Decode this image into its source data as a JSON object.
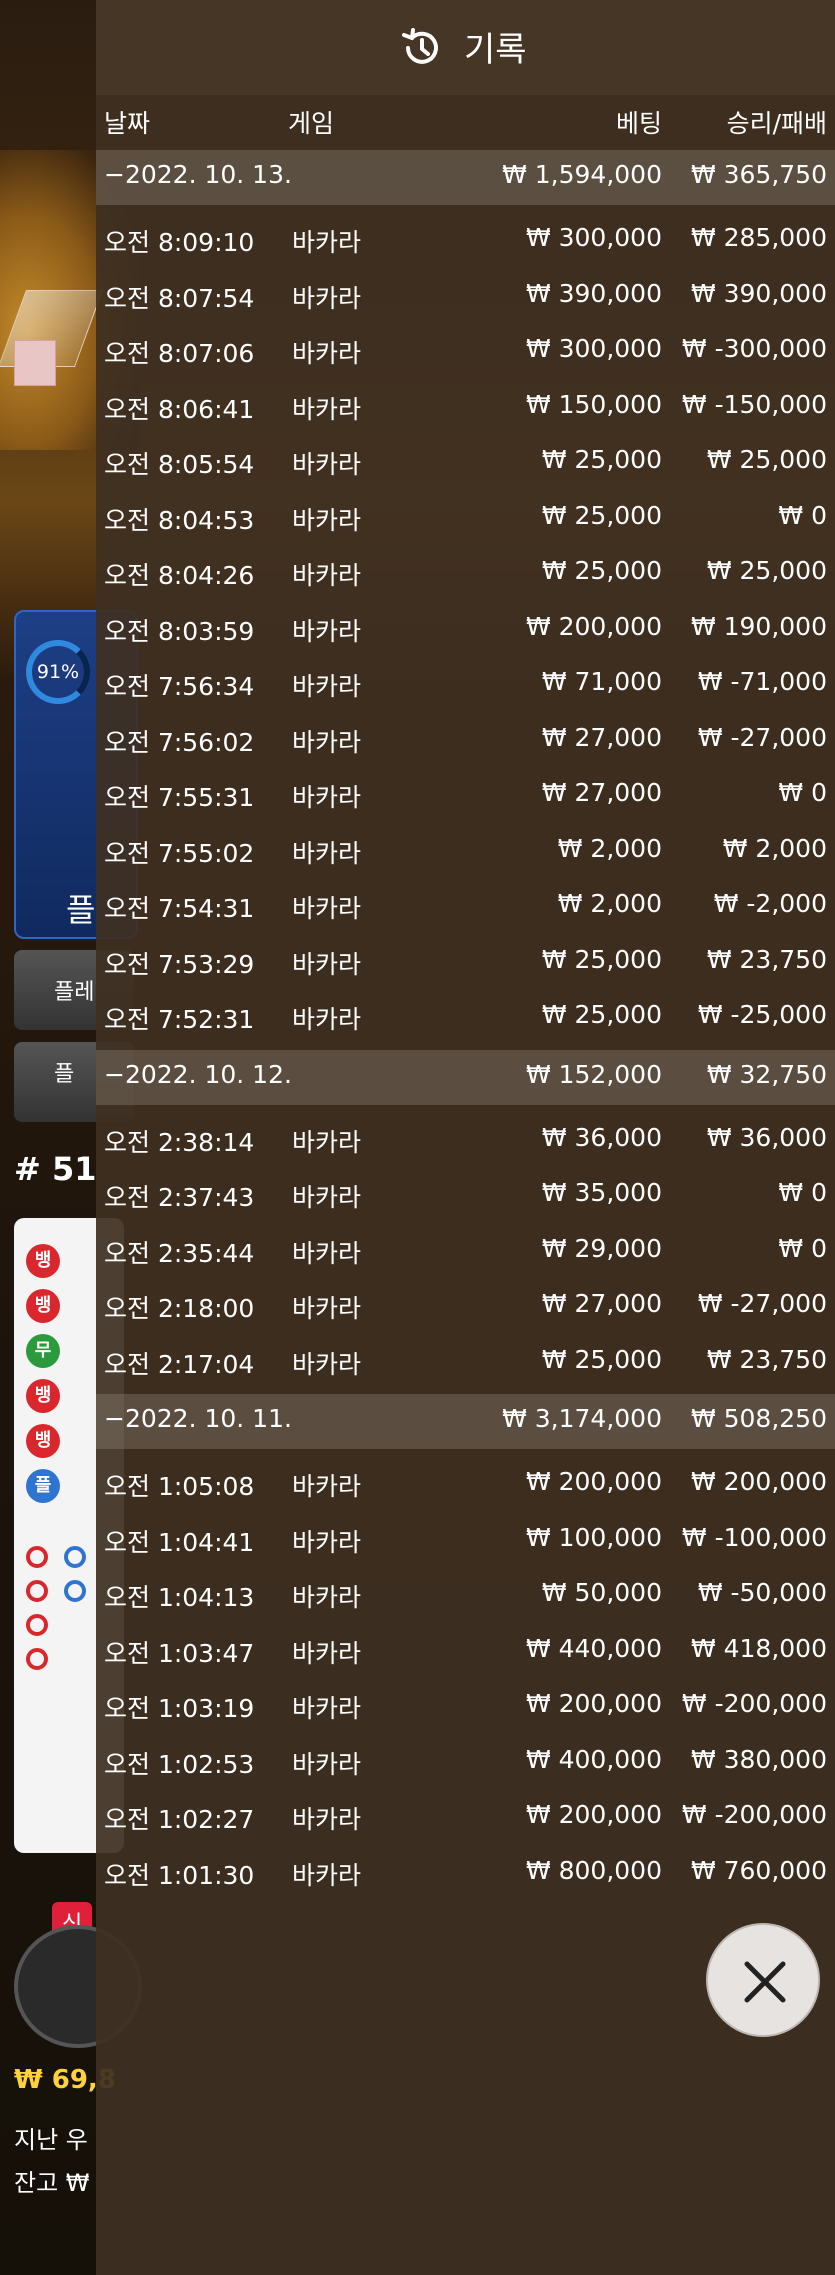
{
  "header": {
    "title": "기록",
    "icon": "history-icon"
  },
  "columns": {
    "date": "날짜",
    "game": "게임",
    "bet": "베팅",
    "result": "승리/패배"
  },
  "groups": [
    {
      "date": "−2022. 10. 13.",
      "bet": "₩ 1,594,000",
      "result": "₩ 365,750",
      "rows": [
        {
          "time": "오전 8:09:10",
          "game": "바카라",
          "bet": "₩ 300,000",
          "result": "₩ 285,000"
        },
        {
          "time": "오전 8:07:54",
          "game": "바카라",
          "bet": "₩ 390,000",
          "result": "₩ 390,000"
        },
        {
          "time": "오전 8:07:06",
          "game": "바카라",
          "bet": "₩ 300,000",
          "result": "₩ -300,000"
        },
        {
          "time": "오전 8:06:41",
          "game": "바카라",
          "bet": "₩ 150,000",
          "result": "₩ -150,000"
        },
        {
          "time": "오전 8:05:54",
          "game": "바카라",
          "bet": "₩ 25,000",
          "result": "₩ 25,000"
        },
        {
          "time": "오전 8:04:53",
          "game": "바카라",
          "bet": "₩ 25,000",
          "result": "₩ 0"
        },
        {
          "time": "오전 8:04:26",
          "game": "바카라",
          "bet": "₩ 25,000",
          "result": "₩ 25,000"
        },
        {
          "time": "오전 8:03:59",
          "game": "바카라",
          "bet": "₩ 200,000",
          "result": "₩ 190,000"
        },
        {
          "time": "오전 7:56:34",
          "game": "바카라",
          "bet": "₩ 71,000",
          "result": "₩ -71,000"
        },
        {
          "time": "오전 7:56:02",
          "game": "바카라",
          "bet": "₩ 27,000",
          "result": "₩ -27,000"
        },
        {
          "time": "오전 7:55:31",
          "game": "바카라",
          "bet": "₩ 27,000",
          "result": "₩ 0"
        },
        {
          "time": "오전 7:55:02",
          "game": "바카라",
          "bet": "₩ 2,000",
          "result": "₩ 2,000"
        },
        {
          "time": "오전 7:54:31",
          "game": "바카라",
          "bet": "₩ 2,000",
          "result": "₩ -2,000"
        },
        {
          "time": "오전 7:53:29",
          "game": "바카라",
          "bet": "₩ 25,000",
          "result": "₩ 23,750"
        },
        {
          "time": "오전 7:52:31",
          "game": "바카라",
          "bet": "₩ 25,000",
          "result": "₩ -25,000"
        }
      ]
    },
    {
      "date": "−2022. 10. 12.",
      "bet": "₩ 152,000",
      "result": "₩ 32,750",
      "rows": [
        {
          "time": "오전 2:38:14",
          "game": "바카라",
          "bet": "₩ 36,000",
          "result": "₩ 36,000"
        },
        {
          "time": "오전 2:37:43",
          "game": "바카라",
          "bet": "₩ 35,000",
          "result": "₩ 0"
        },
        {
          "time": "오전 2:35:44",
          "game": "바카라",
          "bet": "₩ 29,000",
          "result": "₩ 0"
        },
        {
          "time": "오전 2:18:00",
          "game": "바카라",
          "bet": "₩ 27,000",
          "result": "₩ -27,000"
        },
        {
          "time": "오전 2:17:04",
          "game": "바카라",
          "bet": "₩ 25,000",
          "result": "₩ 23,750"
        }
      ]
    },
    {
      "date": "−2022. 10. 11.",
      "bet": "₩ 3,174,000",
      "result": "₩ 508,250",
      "rows": [
        {
          "time": "오전 1:05:08",
          "game": "바카라",
          "bet": "₩ 200,000",
          "result": "₩ 200,000"
        },
        {
          "time": "오전 1:04:41",
          "game": "바카라",
          "bet": "₩ 100,000",
          "result": "₩ -100,000"
        },
        {
          "time": "오전 1:04:13",
          "game": "바카라",
          "bet": "₩ 50,000",
          "result": "₩ -50,000"
        },
        {
          "time": "오전 1:03:47",
          "game": "바카라",
          "bet": "₩ 440,000",
          "result": "₩ 418,000"
        },
        {
          "time": "오전 1:03:19",
          "game": "바카라",
          "bet": "₩ 200,000",
          "result": "₩ -200,000"
        },
        {
          "time": "오전 1:02:53",
          "game": "바카라",
          "bet": "₩ 400,000",
          "result": "₩ 380,000"
        },
        {
          "time": "오전 1:02:27",
          "game": "바카라",
          "bet": "₩ 200,000",
          "result": "₩ -200,000"
        },
        {
          "time": "오전 1:01:30",
          "game": "바카라",
          "bet": "₩ 800,000",
          "result": "₩ 760,000"
        }
      ]
    }
  ],
  "background": {
    "progress_pct": 91,
    "progress_label": "91%",
    "player_label": "플",
    "player_btn_1": "플레",
    "player_btn_2": "플",
    "round": "# 51",
    "new_badge": "신",
    "balance_line": "₩ 69,8",
    "last_win_label": "지난 우",
    "balance_label": "잔고 ₩",
    "road_labels": [
      "뱅",
      "뱅",
      "무",
      "뱅",
      "뱅",
      "플"
    ]
  },
  "close_button": {
    "icon": "close-icon"
  },
  "colors": {
    "overlay": "#3e2f21",
    "group_row": "#968c82",
    "accent_gold": "#ffd23a",
    "banker_red": "#d9272d",
    "player_blue": "#2f74d0",
    "tie_green": "#2a9a3c"
  }
}
